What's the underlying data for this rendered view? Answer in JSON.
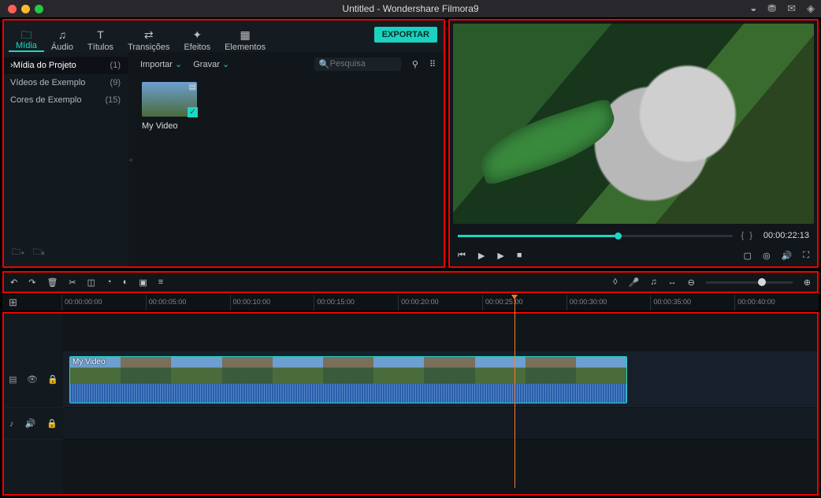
{
  "window": {
    "title": "Untitled - Wondershare Filmora9"
  },
  "titlebar_icons": [
    "user-icon",
    "cart-icon",
    "mail-icon",
    "notification-icon"
  ],
  "tabs": [
    {
      "id": "media",
      "label": "Mídia",
      "icon": "folder-icon",
      "active": true
    },
    {
      "id": "audio",
      "label": "Áudio",
      "icon": "music-icon"
    },
    {
      "id": "titles",
      "label": "Títulos",
      "icon": "text-icon"
    },
    {
      "id": "transitions",
      "label": "Transições",
      "icon": "transition-icon"
    },
    {
      "id": "effects",
      "label": "Efeitos",
      "icon": "sparkle-icon"
    },
    {
      "id": "elements",
      "label": "Elementos",
      "icon": "grid-icon"
    }
  ],
  "export_label": "EXPORTAR",
  "categories": [
    {
      "label": "Mídia do Projeto",
      "count": "(1)",
      "active": true,
      "caret": true
    },
    {
      "label": "Vídeos de Exemplo",
      "count": "(9)"
    },
    {
      "label": "Cores de Exemplo",
      "count": "(15)"
    }
  ],
  "media_toolbar": {
    "import": "Importar",
    "record": "Gravar",
    "search_placeholder": "Pesquisa"
  },
  "clips": [
    {
      "name": "My Video"
    }
  ],
  "preview": {
    "markers": "{  }",
    "timecode": "00:00:22:13"
  },
  "ruler": [
    "00:00:00:00",
    "00:00:05:00",
    "00:00:10:00",
    "00:00:15:00",
    "00:00:20:00",
    "00:00:25:00",
    "00:00:30:00",
    "00:00:35:00",
    "00:00:40:00"
  ],
  "timeline_clip": {
    "label": "My Video"
  },
  "tool_icons": [
    "undo-icon",
    "redo-icon",
    "delete-icon",
    "cut-icon",
    "crop-icon",
    "speed-icon",
    "color-icon",
    "greenscreen-icon",
    "adjust-icon"
  ],
  "tool_icons_right": [
    "marker-icon",
    "mic-icon",
    "mixer-icon",
    "fit-icon",
    "zoom-out-icon",
    "zoom-in-icon"
  ]
}
